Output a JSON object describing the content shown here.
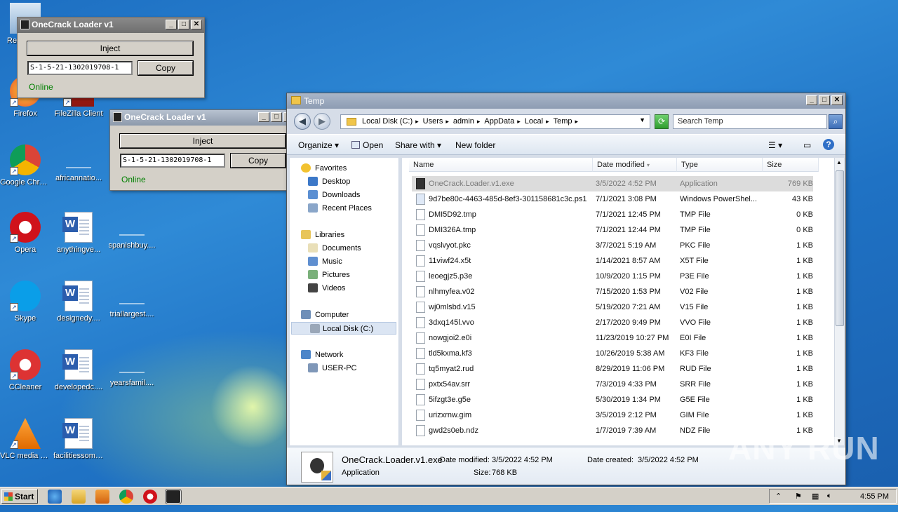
{
  "desktop_icons": [
    {
      "label": "Re...",
      "kind": "recycle"
    },
    {
      "label": "Firefox",
      "kind": "firefox"
    },
    {
      "label": "FileZilla Client",
      "kind": "filezilla"
    },
    {
      "label": "Google Chrome",
      "kind": "chrome"
    },
    {
      "label": "africannatio...",
      "kind": "blank"
    },
    {
      "label": "Opera",
      "kind": "opera"
    },
    {
      "label": "anythingve...",
      "kind": "word"
    },
    {
      "label": "spanishbuy....",
      "kind": "blank"
    },
    {
      "label": "Skype",
      "kind": "skype"
    },
    {
      "label": "designedy....",
      "kind": "word"
    },
    {
      "label": "triallargest....",
      "kind": "blank"
    },
    {
      "label": "CCleaner",
      "kind": "ccleaner"
    },
    {
      "label": "developedc....",
      "kind": "word"
    },
    {
      "label": "yearsfamil....",
      "kind": "blank"
    },
    {
      "label": "VLC media player",
      "kind": "vlc"
    },
    {
      "label": "facilitiessom....",
      "kind": "word"
    }
  ],
  "loaders": [
    {
      "title": "OneCrack Loader v1",
      "inject": "Inject",
      "sid": "S-1-5-21-1302019708-1",
      "copy": "Copy",
      "status": "Online"
    },
    {
      "title": "OneCrack Loader v1",
      "inject": "Inject",
      "sid": "S-1-5-21-1302019708-1",
      "copy": "Copy",
      "status": "Online"
    }
  ],
  "explorer": {
    "title": "Temp",
    "breadcrumbs": [
      "Local Disk (C:)",
      "Users",
      "admin",
      "AppData",
      "Local",
      "Temp"
    ],
    "search_placeholder": "Search Temp",
    "toolbar": {
      "organize": "Organize",
      "open": "Open",
      "share_with": "Share with",
      "new_folder": "New folder"
    },
    "nav": {
      "favorites": "Favorites",
      "desktop": "Desktop",
      "downloads": "Downloads",
      "recent_places": "Recent Places",
      "libraries": "Libraries",
      "documents": "Documents",
      "music": "Music",
      "pictures": "Pictures",
      "videos": "Videos",
      "computer": "Computer",
      "local_disk": "Local Disk (C:)",
      "network": "Network",
      "user_pc": "USER-PC"
    },
    "columns": {
      "name": "Name",
      "date_modified": "Date modified",
      "type": "Type",
      "size": "Size"
    },
    "files": [
      {
        "name": "OneCrack.Loader.v1.exe",
        "date": "3/5/2022 4:52 PM",
        "type": "Application",
        "size": "769 KB"
      },
      {
        "name": "9d7be80c-4463-485d-8ef3-301158681c3c.ps1",
        "date": "7/1/2021 3:08 PM",
        "type": "Windows PowerShel...",
        "size": "43 KB"
      },
      {
        "name": "DMI5D92.tmp",
        "date": "7/1/2021 12:45 PM",
        "type": "TMP File",
        "size": "0 KB"
      },
      {
        "name": "DMI326A.tmp",
        "date": "7/1/2021 12:44 PM",
        "type": "TMP File",
        "size": "0 KB"
      },
      {
        "name": "vqslvyot.pkc",
        "date": "3/7/2021 5:19 AM",
        "type": "PKC File",
        "size": "1 KB"
      },
      {
        "name": "11viwf24.x5t",
        "date": "1/14/2021 8:57 AM",
        "type": "X5T File",
        "size": "1 KB"
      },
      {
        "name": "leoegjz5.p3e",
        "date": "10/9/2020 1:15 PM",
        "type": "P3E File",
        "size": "1 KB"
      },
      {
        "name": "nlhmyfea.v02",
        "date": "7/15/2020 1:53 PM",
        "type": "V02 File",
        "size": "1 KB"
      },
      {
        "name": "wj0mlsbd.v15",
        "date": "5/19/2020 7:21 AM",
        "type": "V15 File",
        "size": "1 KB"
      },
      {
        "name": "3dxq145l.vvo",
        "date": "2/17/2020 9:49 PM",
        "type": "VVO File",
        "size": "1 KB"
      },
      {
        "name": "nowgjoi2.e0i",
        "date": "11/23/2019 10:27 PM",
        "type": "E0I File",
        "size": "1 KB"
      },
      {
        "name": "tld5kxma.kf3",
        "date": "10/26/2019 5:38 AM",
        "type": "KF3 File",
        "size": "1 KB"
      },
      {
        "name": "tq5myat2.rud",
        "date": "8/29/2019 11:06 PM",
        "type": "RUD File",
        "size": "1 KB"
      },
      {
        "name": "pxtx54av.srr",
        "date": "7/3/2019 4:33 PM",
        "type": "SRR File",
        "size": "1 KB"
      },
      {
        "name": "5ifzgt3e.g5e",
        "date": "5/30/2019 1:34 PM",
        "type": "G5E File",
        "size": "1 KB"
      },
      {
        "name": "urizxrnw.gim",
        "date": "3/5/2019 2:12 PM",
        "type": "GIM File",
        "size": "1 KB"
      },
      {
        "name": "gwd2s0eb.ndz",
        "date": "1/7/2019 7:39 AM",
        "type": "NDZ File",
        "size": "1 KB"
      }
    ],
    "details": {
      "filename": "OneCrack.Loader.v1.exe",
      "kind": "Application",
      "date_modified_label": "Date modified:",
      "date_modified": "3/5/2022 4:52 PM",
      "size_label": "Size:",
      "size": "768 KB",
      "date_created_label": "Date created:",
      "date_created": "3/5/2022 4:52 PM"
    }
  },
  "taskbar": {
    "start": "Start",
    "clock": "4:55 PM"
  },
  "watermark": "ANY RUN"
}
